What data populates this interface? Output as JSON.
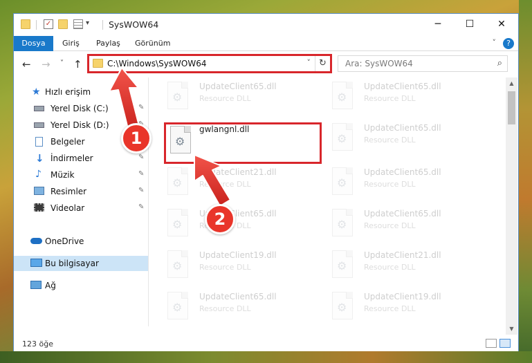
{
  "window": {
    "title": "SysWOW64",
    "controls": {
      "minimize": "─",
      "maximize": "☐",
      "close": "✕"
    }
  },
  "ribbon": {
    "tabs": [
      {
        "label": "Dosya"
      },
      {
        "label": "Giriş"
      },
      {
        "label": "Paylaş"
      },
      {
        "label": "Görünüm"
      }
    ],
    "expand_glyph": "˅",
    "help_glyph": "?"
  },
  "nav": {
    "back": "←",
    "forward": "→",
    "recent": "˅",
    "up": "↑"
  },
  "address_bar": {
    "path": "C:\\Windows\\SysWOW64",
    "dropdown_glyph": "˅",
    "refresh_glyph": "↻"
  },
  "search": {
    "placeholder": "Ara: SysWOW64",
    "icon": "⌕"
  },
  "sidebar": {
    "items": [
      {
        "label": "Hızlı erişim",
        "icon": "star-icon"
      },
      {
        "label": "Yerel Disk (C:)",
        "icon": "drive-icon",
        "pinned": true
      },
      {
        "label": "Yerel Disk (D:)",
        "icon": "drive-icon",
        "pinned": true
      },
      {
        "label": "Belgeler",
        "icon": "document-icon",
        "pinned": true
      },
      {
        "label": "İndirmeler",
        "icon": "download-icon",
        "pinned": true
      },
      {
        "label": "Müzik",
        "icon": "music-icon",
        "pinned": true
      },
      {
        "label": "Resimler",
        "icon": "pictures-icon",
        "pinned": true
      },
      {
        "label": "Videolar",
        "icon": "video-icon",
        "pinned": true
      },
      {
        "label": "OneDrive",
        "icon": "cloud-icon"
      },
      {
        "label": "Bu bilgisayar",
        "icon": "computer-icon",
        "selected": true
      },
      {
        "label": "Ağ",
        "icon": "network-icon"
      }
    ],
    "pin_glyph": "📌"
  },
  "files": {
    "highlighted": {
      "name": "gwlangnl.dll"
    },
    "tiles": [
      {
        "name": "UpdateClient65.dll",
        "type": "Resource DLL"
      },
      {
        "name": "UpdateClient65.dll",
        "type": "Resource DLL"
      },
      {
        "name": "UpdateClient65.dll",
        "type": "Resource DLL"
      },
      {
        "name": "UpdateClient21.dll",
        "type": "Resource DLL"
      },
      {
        "name": "UpdateClient65.dll",
        "type": "Resource DLL"
      },
      {
        "name": "UpdateClient65.dll",
        "type": "Resource DLL"
      },
      {
        "name": "UpdateClient65.dll",
        "type": "Resource DLL"
      },
      {
        "name": "UpdateClient19.dll",
        "type": "Resource DLL"
      },
      {
        "name": "UpdateClient21.dll",
        "type": "Resource DLL"
      },
      {
        "name": "UpdateClient65.dll",
        "type": "Resource DLL"
      },
      {
        "name": "UpdateClient19.dll",
        "type": "Resource DLL"
      }
    ]
  },
  "status": {
    "item_count": "123 öğe"
  },
  "annotations": {
    "step1": "1",
    "step2": "2",
    "color": "#d8262b"
  }
}
